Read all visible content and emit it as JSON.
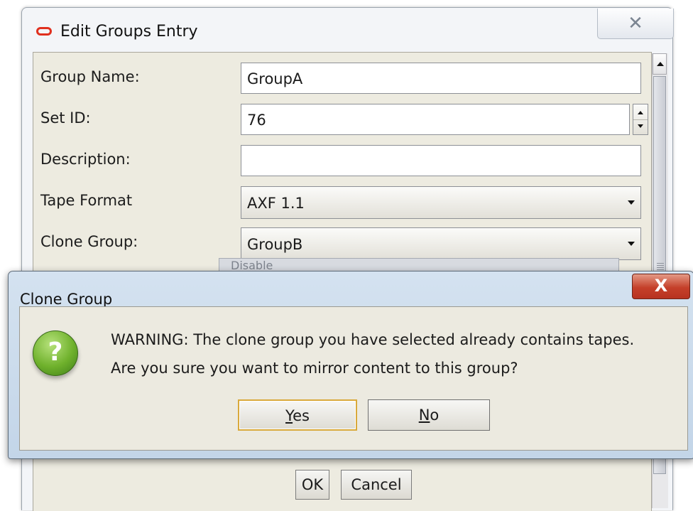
{
  "edit_window": {
    "title": "Edit Groups Entry",
    "close_glyph": "✕",
    "fields": {
      "group_name": {
        "label": "Group Name:",
        "value": "GroupA"
      },
      "set_id": {
        "label": "Set ID:",
        "value": "76"
      },
      "description": {
        "label": "Description:",
        "value": ""
      },
      "tape_format": {
        "label": "Tape Format",
        "value": "AXF 1.1"
      },
      "clone_group": {
        "label": "Clone Group:",
        "value": "GroupB"
      }
    },
    "obscured_field_text": "Disable",
    "ok_label": "OK",
    "cancel_label": "Cancel"
  },
  "clone_dialog": {
    "title": "Clone Group",
    "close_glyph": "X",
    "icon": "question-icon",
    "icon_glyph": "?",
    "message_line1": "WARNING: The clone group you have selected already contains tapes.",
    "message_line2": "Are you sure you want to mirror content to this group?",
    "yes_mnemonic": "Y",
    "yes_rest": "es",
    "no_mnemonic": "N",
    "no_rest": "o"
  },
  "colors": {
    "oracle_red": "#e0301e",
    "close_red": "#c5402a",
    "panel_beige": "#edebe0",
    "question_green": "#6fb12c"
  }
}
